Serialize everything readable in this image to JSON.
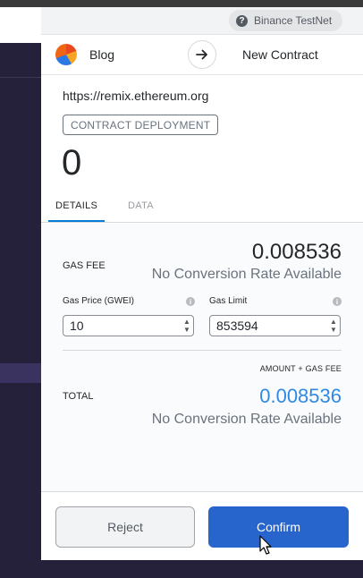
{
  "network": {
    "label": "Binance TestNet",
    "icon": "question-circle-icon"
  },
  "route": {
    "from": "Blog",
    "to": "New Contract",
    "arrow_icon": "arrow-right-icon"
  },
  "origin": "https://remix.ethereum.org",
  "method": "CONTRACT DEPLOYMENT",
  "amount": "0",
  "tabs": [
    {
      "label": "DETAILS",
      "active": true
    },
    {
      "label": "DATA",
      "active": false
    }
  ],
  "gas": {
    "fee_label": "GAS FEE",
    "fee_value": "0.008536",
    "fee_conversion": "No Conversion Rate Available",
    "price_label": "Gas Price (GWEI)",
    "price_value": "10",
    "limit_label": "Gas Limit",
    "limit_value": "853594"
  },
  "total": {
    "subtitle": "AMOUNT + GAS FEE",
    "label": "TOTAL",
    "value": "0.008536",
    "conversion": "No Conversion Rate Available"
  },
  "buttons": {
    "reject": "Reject",
    "confirm": "Confirm"
  },
  "colors": {
    "accent": "#037dd6",
    "confirm": "#2764cc",
    "total_value": "#2f89e4"
  }
}
